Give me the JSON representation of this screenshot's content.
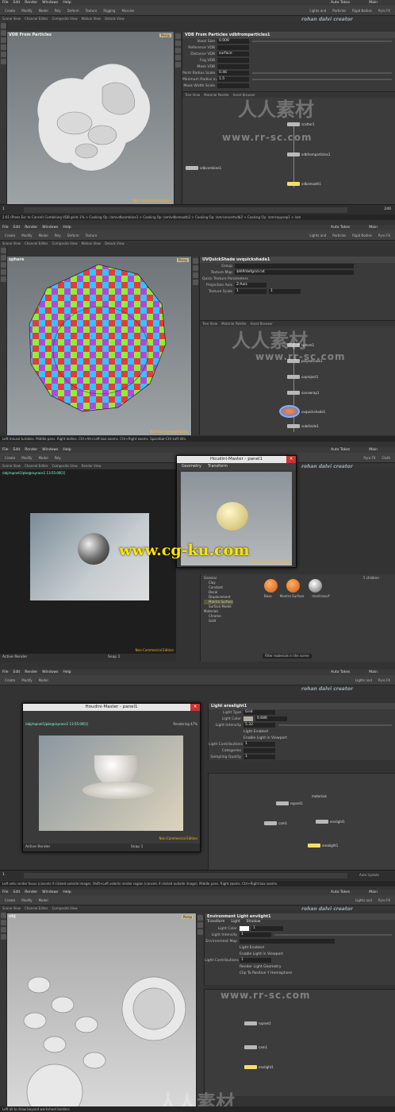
{
  "menu": [
    "File",
    "Edit",
    "Render",
    "Windows",
    "Help"
  ],
  "shelf_tabs": [
    "Create",
    "Modify",
    "Model",
    "Poly",
    "Deform",
    "Texture",
    "Rigging",
    "Muscles",
    "Characters",
    "Constraints",
    "Hair Utils",
    "Guide Process",
    "Terrain FX",
    "Cloud FX",
    "Volume"
  ],
  "shelf_tabs2": [
    "Lights and",
    "Particles",
    "Rigid Bodies",
    "Particle Fl",
    "Viscous Flu",
    "Oceans",
    "Pyro FX",
    "Cloth",
    "Solid",
    "Wires",
    "Crowds",
    "Drive Sim"
  ],
  "scene_tabs": [
    "Scene View",
    "Channel Editor",
    "Composite View",
    "Motion View",
    "Details View",
    "Render View"
  ],
  "main_label": "Main",
  "auto_takes": "Auto Takes",
  "author": "rohan dalvi creator",
  "watermark": "www.rr-sc.com",
  "watermark_cn": "人人素材",
  "cgku": "www.cg-ku.com",
  "persp": "Persp",
  "nce": "Non-Commercial Edition",
  "frame": "1",
  "end_frame": "240",
  "auto_update": "Auto Update",
  "panel1": {
    "path": "obj",
    "viewport_title": "VDB From Particles",
    "node_title": "VDB From Particles  vdbfromparticles1",
    "params": [
      {
        "label": "Voxel Size",
        "value": "0.009"
      },
      {
        "label": "Reference VDB",
        "value": ""
      },
      {
        "label": "Distance VDB",
        "value": "surface"
      },
      {
        "label": "Fog VDB",
        "value": ""
      },
      {
        "label": "Mask VDB",
        "value": ""
      },
      {
        "label": "Point Radius Scale",
        "value": "0.46"
      },
      {
        "label": "Minimum Radius in...",
        "value": "1.5"
      },
      {
        "label": "Mask Width Scale",
        "value": ""
      }
    ],
    "net_tabs": [
      "Tree View",
      "Material Palette",
      "Asset Browser"
    ],
    "nodes": [
      "scatter1",
      "vdbfromparticles1",
      "vdbcombine1",
      "vdbsmooth1"
    ],
    "status": "2:01 (Press Esc to Cancel) Combining VDB grids 1% > Cooking Op: /am/vdbcombine1 > Cooking Op: /am/vdbsmooth2 > Cooking Op: /am/convertvdb2 > Cooking Op: /am/copysop1 > /am"
  },
  "panel2": {
    "path": "sphere",
    "node_title": "UVQuickShade  uvquickshade1",
    "params": [
      {
        "label": "Group",
        "value": ""
      },
      {
        "label": "Texture Map",
        "value": "$HIP/defgrid.rat"
      },
      {
        "label": "Quick Texture Parameters",
        "value": ""
      },
      {
        "label": "Projection Axis",
        "value": "Z-Axis"
      },
      {
        "label": "Texture Scale",
        "value": "1"
      }
    ],
    "net_tabs": [
      "Tree View",
      "Material Palette",
      "Asset Browser"
    ],
    "nodes": [
      "sphere1",
      "polyextrude1",
      "uvproject1",
      "uvunwrap1",
      "uvquickshade1",
      "subdivide1"
    ],
    "status": "Left mouse tumbles. Middle pans. Right dollies. Ctrl+Alt+Left box-zooms. Ctrl+Right zooms. Spacebar-Ctrl-Left tilts."
  },
  "panel3": {
    "path": "/obj/ropnet1/pbr@rayrace1 13:55:09[1]",
    "render_label": "Active Render",
    "snap": "Snap 1",
    "dialog_title": "Houdini-Master - panel1",
    "dialog_tabs": [
      "Geometry",
      "Transform"
    ],
    "tree": [
      "General",
      "Clay",
      "Constant",
      "Decal",
      "Displacement",
      "Mantra Surface",
      "Surface Model",
      "Materials",
      "Chrome",
      "Gold"
    ],
    "materials": [
      "Base",
      "Mantra Surface",
      "mantrasurf"
    ],
    "filter": "Filter materials in the scene",
    "children": "5 children"
  },
  "panel4": {
    "dialog_title": "Houdini-Master - panel1",
    "path": "/obj/ropnet1/pbr@rayrace1 13:55:09[1]",
    "rendering": "Rendering 47%",
    "render_label": "Active Render",
    "snap": "Snap 1",
    "node_title": "Light  arealight1",
    "params": [
      {
        "label": "Light Type",
        "value": "Grid"
      },
      {
        "label": "Light Color",
        "value": "0.686"
      },
      {
        "label": "Light Intensity",
        "value": "5.32"
      },
      {
        "label": "",
        "value": "Light Enabled"
      },
      {
        "label": "",
        "value": "Enable Light in Viewport"
      },
      {
        "label": "Light Contributions",
        "value": "1"
      },
      {
        "label": "Categories",
        "value": ""
      },
      {
        "label": "Sampling Quality",
        "value": "1"
      }
    ],
    "nodes": [
      "cam1",
      "ropnet1",
      "envlight1",
      "arealight1",
      "materials"
    ],
    "status": "Left sets render focus (cancels if clicked outside image). Shift+Left selects render region (cancels if clicked outside image). Middle pans. Right zooms. Ctrl+Right box zooms."
  },
  "panel5": {
    "path": "obj",
    "node_title": "Environment Light  envlight1",
    "param_tabs": [
      "Transform",
      "Light",
      "Shadow"
    ],
    "params": [
      {
        "label": "Light Color",
        "value": "1"
      },
      {
        "label": "Light Intensity",
        "value": "1"
      },
      {
        "label": "Environment Map",
        "value": ""
      },
      {
        "label": "",
        "value": "Light Enabled"
      },
      {
        "label": "",
        "value": "Enable Light in Viewport"
      },
      {
        "label": "Light Contributions",
        "value": "1"
      },
      {
        "label": "",
        "value": "Render Light Geometry"
      },
      {
        "label": "",
        "value": "Clip To Positive Y Hemisphere"
      }
    ],
    "nodes": [
      "ropnet1",
      "cam1",
      "envlight1"
    ],
    "status": "Left  all to draw beyond worksheet borders"
  }
}
